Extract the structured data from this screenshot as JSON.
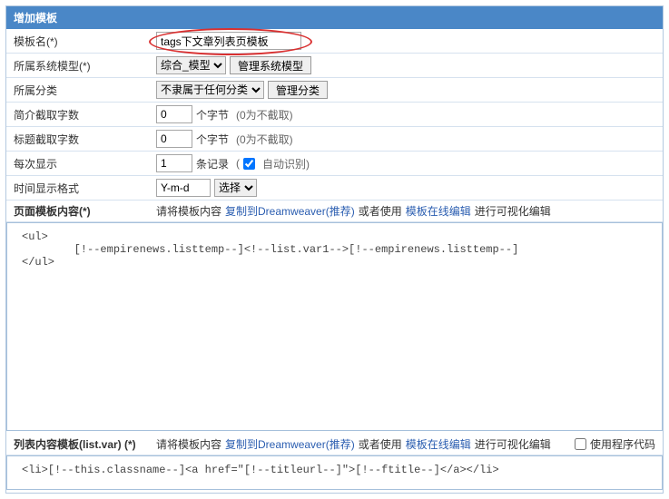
{
  "panel_title": "增加模板",
  "rows": {
    "name": {
      "label": "模板名(*)",
      "value": "tags下文章列表页模板"
    },
    "sysmodel": {
      "label": "所属系统模型(*)",
      "select": "综合_模型",
      "button": "管理系统模型"
    },
    "category": {
      "label": "所属分类",
      "select": "不隶属于任何分类",
      "button": "管理分类"
    },
    "intro_chars": {
      "label": "简介截取字数",
      "value": "0",
      "unit": "个字节",
      "hint": "(0为不截取)"
    },
    "title_chars": {
      "label": "标题截取字数",
      "value": "0",
      "unit": "个字节",
      "hint": "(0为不截取)"
    },
    "per_page": {
      "label": "每次显示",
      "value": "1",
      "unit": "条记录",
      "checkbox": true,
      "check_label": "自动识别)"
    },
    "time_format": {
      "label": "时间显示格式",
      "value": "Y-m-d",
      "button": "选择"
    },
    "page_content": {
      "label": "页面模板内容(*)",
      "text1": "请将模板内容",
      "link1": "复制到Dreamweaver(推荐)",
      "text2": "或者使用",
      "link2": "模板在线编辑",
      "text3": "进行可视化编辑"
    },
    "list_content": {
      "label": "列表内容模板(list.var) (*)",
      "text1": "请将模板内容",
      "link1": "复制到Dreamweaver(推荐)",
      "text2": "或者使用",
      "link2": "模板在线编辑",
      "text3": "进行可视化编辑",
      "use_code": "使用程序代码"
    }
  },
  "code1": "<ul>\n        [!--empirenews.listtemp--]<!--list.var1-->[!--empirenews.listtemp--]\n</ul>",
  "code2": "<li>[!--this.classname--]<a href=\"[!--titleurl--]\">[!--ftitle--]</a></li>"
}
